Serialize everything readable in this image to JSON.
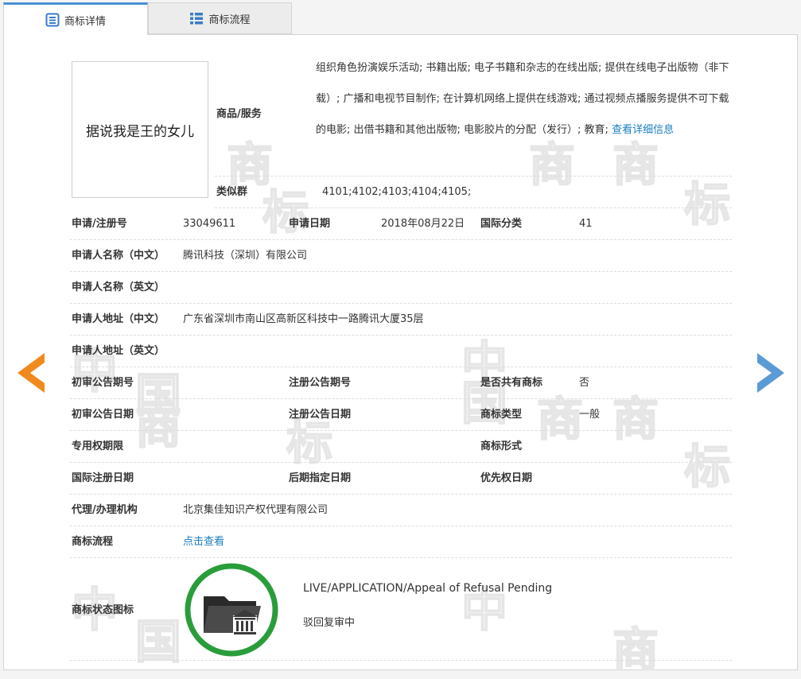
{
  "tabs": [
    {
      "label": "商标详情",
      "active": true,
      "icon": "document-list-icon"
    },
    {
      "label": "商标流程",
      "active": false,
      "icon": "list-icon"
    }
  ],
  "watermark": {
    "chars": [
      "商",
      "标",
      "中",
      "国"
    ]
  },
  "trademark": {
    "image_text": "据说我是王的女儿"
  },
  "goods": {
    "label": "商品/服务",
    "text": "组织角色扮演娱乐活动; 书籍出版; 电子书籍和杂志的在线出版; 提供在线电子出版物（非下载）; 广播和电视节目制作; 在计算机网络上提供在线游戏; 通过视频点播服务提供不可下载的电影; 出借书籍和其他出版物; 电影胶片的分配（发行）; 教育; ",
    "more_link": "查看详细信息"
  },
  "similar_group": {
    "label": "类似群",
    "value": "4101;4102;4103;4104;4105;"
  },
  "registration": {
    "reg_no_label": "申请/注册号",
    "reg_no": "33049611",
    "apply_date_label": "申请日期",
    "apply_date": "2018年08月22日",
    "intl_class_label": "国际分类",
    "intl_class": "41"
  },
  "applicant": {
    "name_cn_label": "申请人名称（中文）",
    "name_cn": "腾讯科技（深圳）有限公司",
    "name_en_label": "申请人名称（英文）",
    "name_en": "",
    "addr_cn_label": "申请人地址（中文）",
    "addr_cn": "广东省深圳市南山区高新区科技中一路腾讯大厦35层",
    "addr_en_label": "申请人地址（英文）",
    "addr_en": ""
  },
  "announce": {
    "prelim_no_label": "初审公告期号",
    "prelim_no": "",
    "reg_no_label": "注册公告期号",
    "reg_no": "",
    "shared_label": "是否共有商标",
    "shared": "否",
    "prelim_date_label": "初审公告日期",
    "prelim_date": "",
    "reg_date_label": "注册公告日期",
    "reg_date": "",
    "type_label": "商标类型",
    "type": "一般",
    "exclusive_label": "专用权期限",
    "exclusive": "",
    "form_label": "商标形式",
    "form": "",
    "intl_reg_label": "国际注册日期",
    "intl_reg": "",
    "later_label": "后期指定日期",
    "later": "",
    "priority_label": "优先权日期",
    "priority": ""
  },
  "agency": {
    "label": "代理/办理机构",
    "value": "北京集佳知识产权代理有限公司"
  },
  "process": {
    "label": "商标流程",
    "link": "点击查看"
  },
  "status": {
    "label": "商标状态图标",
    "en": "LIVE/APPLICATION/Appeal of Refusal Pending",
    "cn": "驳回复审中",
    "icon": "folder-courthouse-icon",
    "ring_color": "#2a9d3b"
  },
  "nav": {
    "prev_color": "#f08a1c",
    "next_color": "#5b9bd5"
  }
}
